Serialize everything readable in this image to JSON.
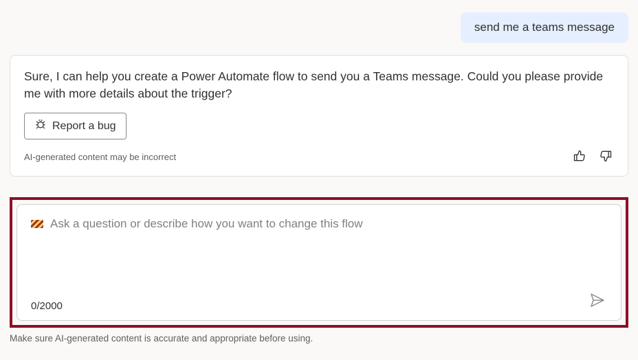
{
  "chat": {
    "user_message": "send me a teams message",
    "assistant_message": "Sure, I can help you create a Power Automate flow to send you a Teams message. Could you please provide me with more details about the trigger?",
    "report_bug_label": "Report a bug",
    "assistant_disclaimer": "AI-generated content may be incorrect"
  },
  "input": {
    "placeholder": "Ask a question or describe how you want to change this flow",
    "char_count": "0/2000"
  },
  "footer": {
    "disclaimer": "Make sure AI-generated content is accurate and appropriate before using."
  }
}
